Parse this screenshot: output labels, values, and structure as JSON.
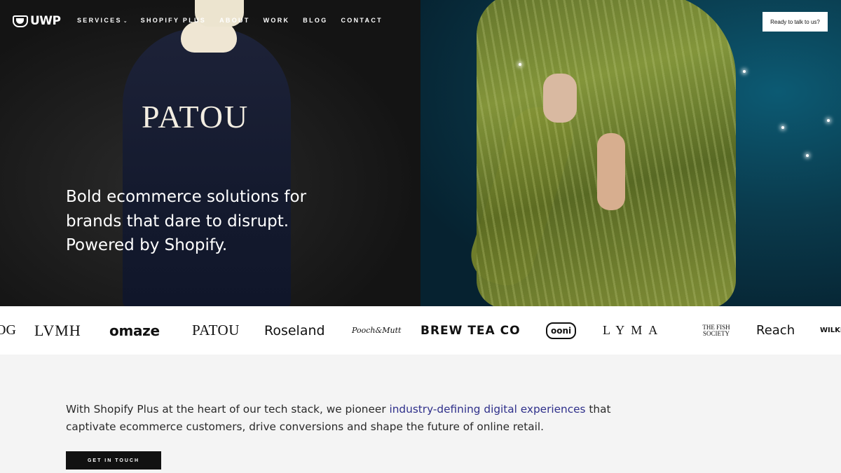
{
  "nav": {
    "logo_text": "UWP",
    "links": [
      {
        "label": "SERVICES",
        "has_dropdown": true
      },
      {
        "label": "SHOPIFY PLUS"
      },
      {
        "label": "ABOUT"
      },
      {
        "label": "WORK"
      },
      {
        "label": "BLOG"
      },
      {
        "label": "CONTACT"
      }
    ],
    "cta_label": "Ready to talk to us?"
  },
  "hero": {
    "line1": "Bold ecommerce solutions for",
    "line2": "brands that dare to disrupt.",
    "line3": "Powered by Shopify.",
    "image_print": "PATOU"
  },
  "brands": {
    "partial_left": "OG",
    "lvmh": "LVMH",
    "omaze": "omaze",
    "patou": "PATOU",
    "roseland": "Roseland",
    "pooch": "Pooch&Mutt",
    "brew": "BREW TEA CO",
    "ooni": "ooni",
    "lyma": "LYMA",
    "fish": "THE FISH SOCIETY",
    "reach": "Reach",
    "wilk": "WILKI"
  },
  "intro": {
    "text_before": "With Shopify Plus at the heart of our tech stack, we pioneer ",
    "highlight": "industry-defining digital experiences",
    "text_after": " that captivate ecommerce customers, drive conversions and shape the future of online retail.",
    "cta_label": "GET IN TOUCH"
  },
  "colors": {
    "accent_link": "#2e2f8a",
    "button_dark": "#111111"
  }
}
